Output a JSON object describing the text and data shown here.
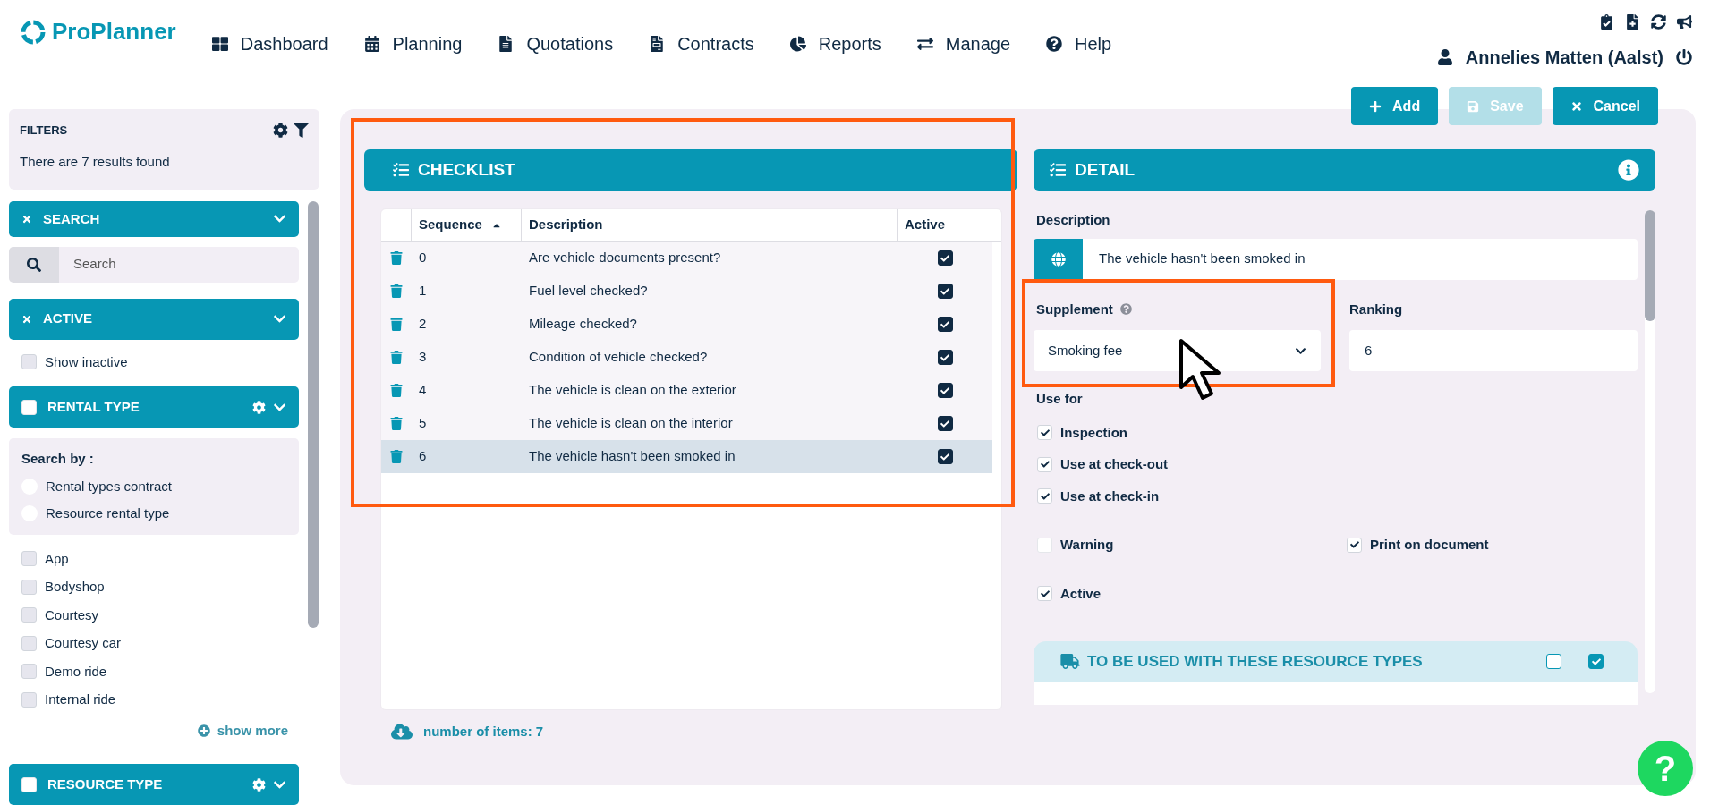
{
  "header": {
    "logo": "ProPlanner",
    "nav": [
      {
        "label": "Dashboard"
      },
      {
        "label": "Planning"
      },
      {
        "label": "Quotations"
      },
      {
        "label": "Contracts"
      },
      {
        "label": "Reports"
      },
      {
        "label": "Manage"
      },
      {
        "label": "Help"
      }
    ],
    "user": "Annelies Matten (Aalst)"
  },
  "toolbar": [
    {
      "kind": "add",
      "label": "Add",
      "disabled": false
    },
    {
      "kind": "save",
      "label": "Save",
      "disabled": true
    },
    {
      "kind": "cancel",
      "label": "Cancel",
      "disabled": false
    }
  ],
  "filters": {
    "title": "FILTERS",
    "results": "There are 7 results found"
  },
  "sidebar": {
    "search": {
      "title": "SEARCH",
      "placeholder": "Search"
    },
    "active": {
      "title": "ACTIVE",
      "options": [
        {
          "label": "Show inactive",
          "checked": false
        }
      ]
    },
    "rental_type": {
      "title": "RENTAL TYPE",
      "checked": false,
      "search_by": "Search by :",
      "radios": [
        {
          "label": "Rental types contract",
          "selected": false
        },
        {
          "label": "Resource rental type",
          "selected": false
        }
      ],
      "options": [
        {
          "label": "App",
          "checked": false
        },
        {
          "label": "Bodyshop",
          "checked": false
        },
        {
          "label": "Courtesy",
          "checked": false
        },
        {
          "label": "Courtesy car",
          "checked": false
        },
        {
          "label": "Demo ride",
          "checked": false
        },
        {
          "label": "Internal ride",
          "checked": false
        }
      ],
      "show_more": "show more"
    },
    "resource_type": {
      "title": "RESOURCE TYPE",
      "checked": false
    }
  },
  "checklist": {
    "title": "CHECKLIST",
    "columns": [
      {
        "label": "Sequence",
        "sorted": true
      },
      {
        "label": "Description",
        "sorted": false
      },
      {
        "label": "Active",
        "sorted": false
      }
    ],
    "rows": [
      {
        "sequence": "0",
        "description": "Are vehicle documents present?",
        "active": true,
        "selected": false
      },
      {
        "sequence": "1",
        "description": "Fuel level checked?",
        "active": true,
        "selected": false
      },
      {
        "sequence": "2",
        "description": "Mileage checked?",
        "active": true,
        "selected": false
      },
      {
        "sequence": "3",
        "description": "Condition of vehicle checked?",
        "active": true,
        "selected": false
      },
      {
        "sequence": "4",
        "description": "The vehicle is clean on the exterior",
        "active": true,
        "selected": false
      },
      {
        "sequence": "5",
        "description": "The vehicle is clean on the interior",
        "active": true,
        "selected": false
      },
      {
        "sequence": "6",
        "description": "The vehicle hasn't been smoked in",
        "active": true,
        "selected": true
      }
    ],
    "footer": "number of items: 7"
  },
  "detail": {
    "title": "DETAIL",
    "description": {
      "label": "Description",
      "value": "The vehicle hasn't been smoked in"
    },
    "supplement": {
      "label": "Supplement",
      "value": "Smoking fee"
    },
    "ranking": {
      "label": "Ranking",
      "value": "6"
    },
    "use_for": {
      "label": "Use for",
      "options": [
        {
          "label": "Inspection",
          "checked": true
        },
        {
          "label": "Use at check-out",
          "checked": true
        },
        {
          "label": "Use at check-in",
          "checked": true
        }
      ]
    },
    "warning": {
      "label": "Warning",
      "checked": false
    },
    "print_on_document": {
      "label": "Print on document",
      "checked": true
    },
    "active": {
      "label": "Active",
      "checked": true
    },
    "resource_types": {
      "title": "TO BE USED WITH THESE RESOURCE TYPES",
      "toggles": [
        {
          "checked": false
        },
        {
          "checked": true
        }
      ]
    }
  },
  "help_button": "?"
}
